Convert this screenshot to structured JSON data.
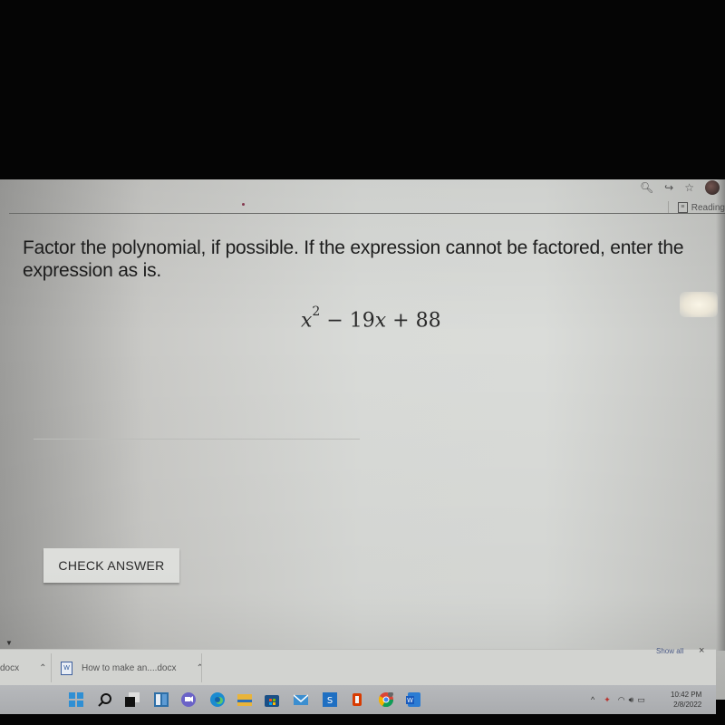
{
  "browser": {
    "toolbar_icons": [
      "zoom-icon",
      "share-icon",
      "star-icon",
      "profile-avatar"
    ],
    "reading_list_label": "Reading list",
    "reading_list_visible": "Reading"
  },
  "question": {
    "prompt": "Factor the polynomial, if possible. If the expression cannot be factored, enter the expression as is.",
    "expression": {
      "base": "x",
      "exponent": "2",
      "rest": " − 19",
      "var2": "x",
      "tail": " + 88"
    },
    "answer_value": ""
  },
  "actions": {
    "check_answer": "CHECK ANSWER"
  },
  "downloads_bar": {
    "items": [
      {
        "name": "docx"
      },
      {
        "name": "How to make an....docx"
      }
    ],
    "show_all": "Show all",
    "close": "×"
  },
  "taskbar": {
    "apps": [
      "start",
      "search",
      "task-view",
      "widgets",
      "teams-chat",
      "edge",
      "file-explorer",
      "microsoft-store",
      "mail",
      "app-s",
      "office",
      "chrome",
      "word"
    ],
    "tray": {
      "chevron": "^",
      "clock_time": "10:42 PM",
      "clock_date": "2/8/2022"
    }
  }
}
